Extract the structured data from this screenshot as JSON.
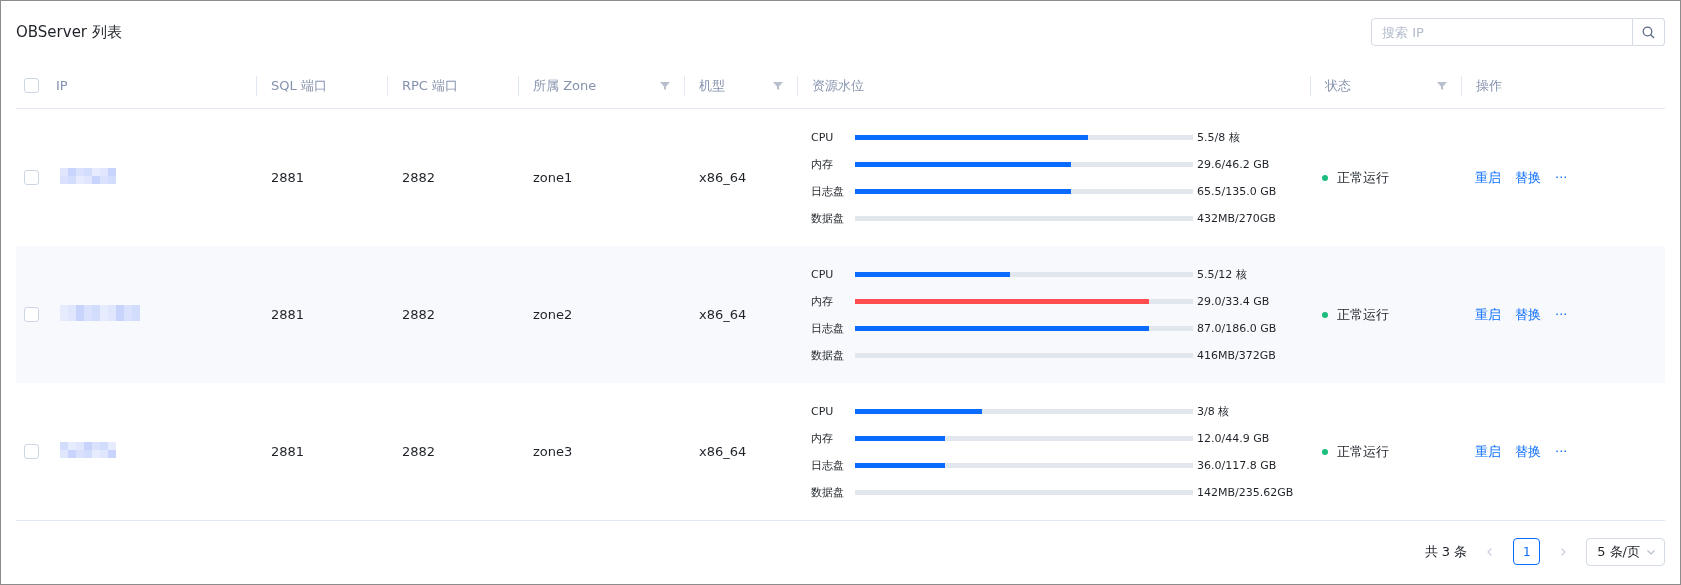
{
  "title": "OBServer 列表",
  "search": {
    "placeholder": "搜索 IP"
  },
  "header_checkbox": {
    "checked": false
  },
  "columns": [
    {
      "label": "IP",
      "filter": false
    },
    {
      "label": "SQL 端口",
      "filter": false
    },
    {
      "label": "RPC 端口",
      "filter": false
    },
    {
      "label": "所属 Zone",
      "filter": true
    },
    {
      "label": "机型",
      "filter": true
    },
    {
      "label": "资源水位",
      "filter": false
    },
    {
      "label": "状态",
      "filter": true
    },
    {
      "label": "操作",
      "filter": false
    }
  ],
  "rows": [
    {
      "checked": false,
      "sql_port": "2881",
      "rpc_port": "2882",
      "zone": "zone1",
      "machine_type": "x86_64",
      "resources": [
        {
          "label": "CPU",
          "level": 0.69,
          "reading": "5.5/8 核",
          "color": "#0a6cff"
        },
        {
          "label": "内存",
          "level": 0.64,
          "reading": "29.6/46.2 GB",
          "color": "#0a6cff"
        },
        {
          "label": "日志盘",
          "level": 0.64,
          "reading": "65.5/135.0 GB",
          "color": "#0a6cff"
        },
        {
          "label": "数据盘",
          "reading": "432MB/270GB"
        }
      ],
      "status": "正常运行",
      "actions": [
        "重启",
        "替换",
        "···"
      ]
    },
    {
      "checked": false,
      "sql_port": "2881",
      "rpc_port": "2882",
      "zone": "zone2",
      "machine_type": "x86_64",
      "resources": [
        {
          "label": "CPU",
          "level": 0.46,
          "reading": "5.5/12 核",
          "color": "#0a6cff"
        },
        {
          "label": "内存",
          "level": 0.87,
          "reading": "29.0/33.4 GB",
          "color": "#ff4d4f"
        },
        {
          "label": "日志盘",
          "level": 0.87,
          "reading": "87.0/186.0 GB",
          "color": "#0a6cff"
        },
        {
          "label": "数据盘",
          "reading": "416MB/372GB"
        }
      ],
      "status": "正常运行",
      "actions": [
        "重启",
        "替换",
        "···"
      ]
    },
    {
      "checked": false,
      "sql_port": "2881",
      "rpc_port": "2882",
      "zone": "zone3",
      "machine_type": "x86_64",
      "resources": [
        {
          "label": "CPU",
          "level": 0.377,
          "reading": "3/8 核",
          "color": "#0a6cff"
        },
        {
          "label": "内存",
          "level": 0.265,
          "reading": "12.0/44.9 GB",
          "color": "#0a6cff"
        },
        {
          "label": "日志盘",
          "level": 0.265,
          "reading": "36.0/117.8 GB",
          "color": "#0a6cff"
        },
        {
          "label": "数据盘",
          "reading": "142MB/235.62GB"
        }
      ],
      "status": "正常运行",
      "actions": [
        "重启",
        "替换",
        "···"
      ]
    }
  ],
  "pagination": {
    "total": "共 3 条",
    "pages": [
      {
        "label": "1",
        "selected": true
      }
    ],
    "page_size": "5 条/页"
  }
}
